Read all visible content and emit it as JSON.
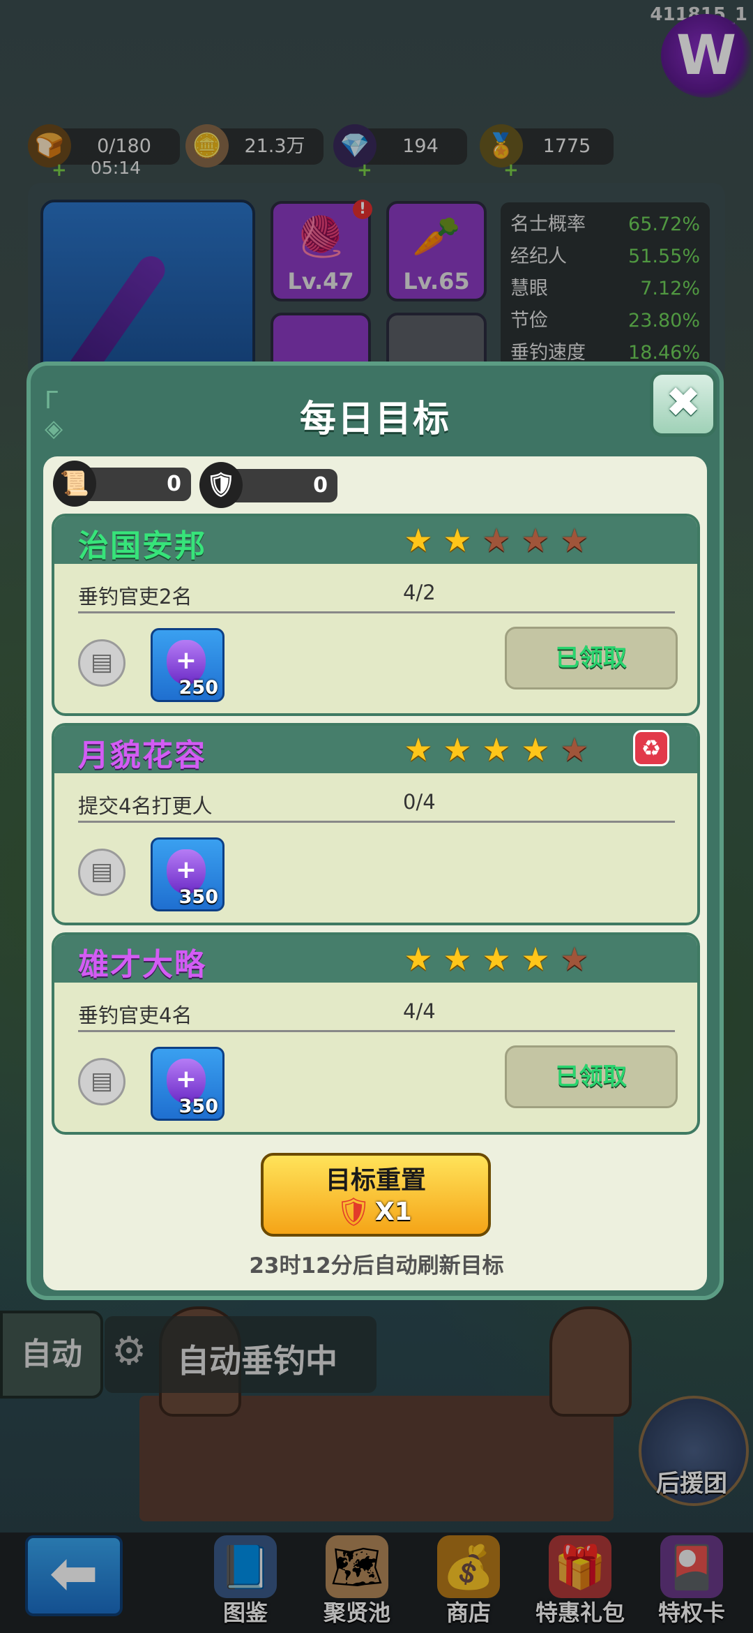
{
  "top": {
    "corner_id": "411815_1",
    "logo_letter": "W",
    "resources": [
      {
        "icon": "bait-icon",
        "value": "0/180",
        "glyph": "🍞"
      },
      {
        "icon": "coin-icon",
        "value": "21.3万",
        "glyph": "🪙"
      },
      {
        "icon": "gem-icon",
        "value": "194",
        "glyph": "💎"
      },
      {
        "icon": "gold-icon",
        "value": "1775",
        "glyph": "🏅"
      }
    ],
    "timer": "05:14"
  },
  "background_panel": {
    "skills": [
      {
        "level": "Lv.47",
        "glyph": "🧶",
        "alert": "!"
      },
      {
        "level": "Lv.65",
        "glyph": "🥕"
      }
    ],
    "stats": [
      {
        "name": "名士概率",
        "value": "65.72%"
      },
      {
        "name": "经纪人",
        "value": "51.55%"
      },
      {
        "name": "慧眼",
        "value": "7.12%"
      },
      {
        "name": "节俭",
        "value": "23.80%"
      },
      {
        "name": "垂钓速度",
        "value": "18.46%"
      }
    ]
  },
  "modal": {
    "title": "每日目标",
    "close_glyph": "✖",
    "currencies": [
      {
        "icon": "scroll-icon",
        "glyph": "📜",
        "value": "0"
      },
      {
        "icon": "shield-badge-icon",
        "glyph": "🛡",
        "value": "0"
      }
    ],
    "goals": [
      {
        "title": "治国安邦",
        "title_color": "green",
        "stars_on": 2,
        "stars_total": 5,
        "task": "垂钓官吏2名",
        "progress": "4/2",
        "reward_amount": "250",
        "claim_label": "已领取",
        "claimed": true,
        "has_refresh": false
      },
      {
        "title": "月貌花容",
        "title_color": "purple",
        "stars_on": 4,
        "stars_total": 5,
        "task": "提交4名打更人",
        "progress": "0/4",
        "reward_amount": "350",
        "claim_label": "",
        "claimed": false,
        "has_refresh": true
      },
      {
        "title": "雄才大略",
        "title_color": "purple",
        "stars_on": 4,
        "stars_total": 5,
        "task": "垂钓官吏4名",
        "progress": "4/4",
        "reward_amount": "350",
        "claim_label": "已领取",
        "claimed": true,
        "has_refresh": false
      }
    ],
    "reset_button": {
      "label": "目标重置",
      "count": "X1"
    },
    "refresh_note": "23时12分后自动刷新目标"
  },
  "bottom": {
    "auto_button": "自动",
    "auto_status": "自动垂钓中",
    "support_label": "后援团",
    "nav": [
      {
        "label": "图鉴",
        "icon": "encyclopedia-icon",
        "glyph": "📘"
      },
      {
        "label": "聚贤池",
        "icon": "map-icon",
        "glyph": "🗺"
      },
      {
        "label": "商店",
        "icon": "shop-icon",
        "glyph": "💰"
      },
      {
        "label": "特惠礼包",
        "icon": "gift-pack-icon",
        "glyph": "🎁"
      },
      {
        "label": "特权卡",
        "icon": "privilege-card-icon",
        "glyph": "🎴"
      }
    ]
  },
  "colors": {
    "title_green": "#37e47a",
    "title_purple": "#d35cf4",
    "star_on": "#ffc61a",
    "star_off": "#a0553a",
    "claimed_text": "#29d46e"
  }
}
